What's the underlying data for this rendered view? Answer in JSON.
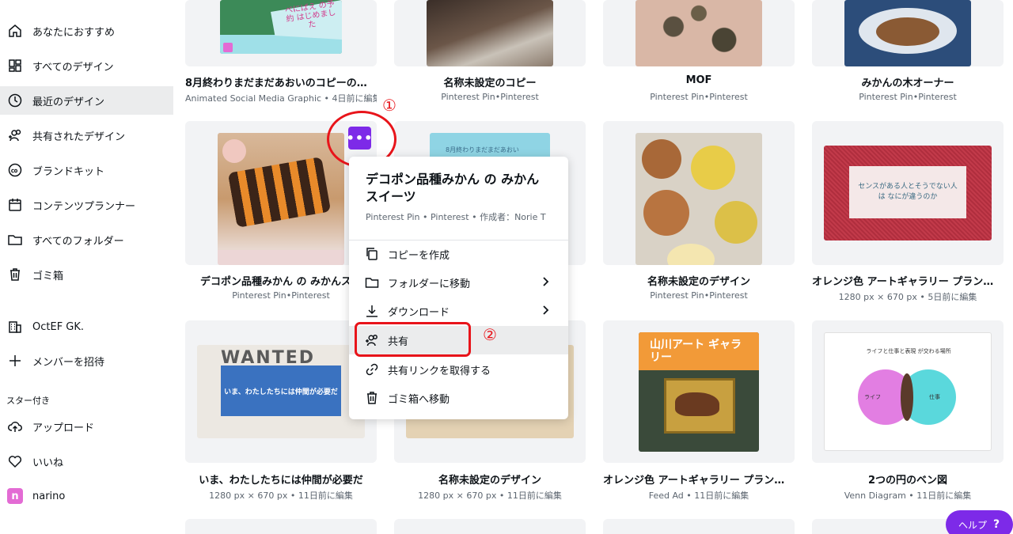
{
  "sidebar": {
    "items": [
      {
        "label": "あなたにおすすめ",
        "icon": "home-icon"
      },
      {
        "label": "すべてのデザイン",
        "icon": "grid-icon"
      },
      {
        "label": "最近のデザイン",
        "icon": "clock-icon"
      },
      {
        "label": "共有されたデザイン",
        "icon": "shared-users-icon"
      },
      {
        "label": "ブランドキット",
        "icon": "brand-kit-icon"
      },
      {
        "label": "コンテンツプランナー",
        "icon": "calendar-icon"
      },
      {
        "label": "すべてのフォルダー",
        "icon": "folder-icon"
      },
      {
        "label": "ゴミ箱",
        "icon": "trash-icon"
      }
    ],
    "team": {
      "name": "OctEF GK.",
      "invite": "メンバーを招待"
    },
    "starred_label": "スター付き",
    "starred": [
      {
        "label": "アップロード",
        "icon": "upload-cloud-icon"
      },
      {
        "label": "いいね",
        "icon": "heart-icon"
      },
      {
        "label": "narino",
        "icon": "narino-avatar"
      }
    ]
  },
  "cards": [
    {
      "title": "8月終わりまだまだあおいのコピーのコ...",
      "sub": "Animated Social Media Graphic • 4日前に編集",
      "thumb_text": "べにばえ の予約 はじめました"
    },
    {
      "title": "名称未設定のコピー",
      "sub": "Pinterest Pin•Pinterest"
    },
    {
      "title": "MOF",
      "sub": "Pinterest Pin•Pinterest"
    },
    {
      "title": "みかんの木オーナー",
      "sub": "Pinterest Pin•Pinterest"
    },
    {
      "title": "デコポン品種みかん の みかんスイ",
      "sub": "Pinterest Pin•Pinterest"
    },
    {
      "title": "",
      "sub": "",
      "thumb_text": "8月終わりまだまだあおい"
    },
    {
      "title": "名称未設定のデザイン",
      "sub": "Pinterest Pin•Pinterest"
    },
    {
      "title": "オレンジ色 アートギャラリー プランデ...",
      "sub": "1280 px × 670 px • 5日前に編集",
      "thumb_text": "センスがある人とそうでない人は なにが違うのか"
    },
    {
      "title": "いま、わたしたちには仲間が必要だ",
      "sub": "1280 px × 670 px • 11日前に編集",
      "thumb_text": "いま、わたしたちには仲間が必要だ",
      "thumb_text2": "WANTED"
    },
    {
      "title": "名称未設定のデザイン",
      "sub": "1280 px × 670 px • 11日前に編集"
    },
    {
      "title": "オレンジ色 アートギャラリー プランデ...",
      "sub": "Feed Ad • 11日前に編集",
      "thumb_text": "山川アート ギャラリー"
    },
    {
      "title": "2つの円のベン図",
      "sub": "Venn Diagram • 11日前に編集",
      "venn_title": "ライフと仕事と表現 が交わる場所",
      "venn_left": "ライフ",
      "venn_right": "仕事"
    }
  ],
  "menu": {
    "title": "デコポン品種みかん の みかん スイーツ",
    "sub": "Pinterest Pin • Pinterest • 作成者：Norie T",
    "items": [
      {
        "label": "コピーを作成",
        "icon": "copy-icon"
      },
      {
        "label": "フォルダーに移動",
        "icon": "folder-icon"
      },
      {
        "label": "ダウンロード",
        "icon": "download-icon"
      },
      {
        "label": "共有",
        "icon": "share-users-icon"
      },
      {
        "label": "共有リンクを取得する",
        "icon": "link-icon"
      },
      {
        "label": "ゴミ箱へ移動",
        "icon": "trash-icon"
      }
    ]
  },
  "more_button": "•••",
  "annotations": {
    "one": "①",
    "two": "②"
  },
  "help": {
    "label": "ヘルプ",
    "mark": "?"
  },
  "colors": {
    "accent": "#7d2ae8",
    "annotation": "#e8141a"
  }
}
